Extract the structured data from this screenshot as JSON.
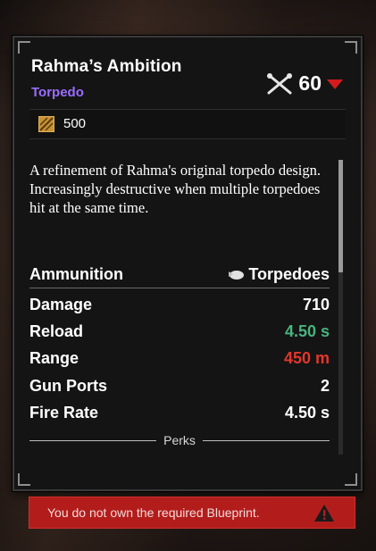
{
  "item": {
    "name": "Rahma’s Ambition",
    "type": "Torpedo",
    "power_value": "60",
    "power_icon": "crossed-cannons-icon",
    "power_trend_icon": "down-triangle-icon",
    "cost_value": "500",
    "cost_icon": "material-crate-icon",
    "description": "A refinement of Rahma's original torpedo design. Increasingly destructive when multiple torpedoes hit at the same time."
  },
  "ammunition": {
    "label": "Ammunition",
    "value": "Torpedoes",
    "icon": "torpedo-icon"
  },
  "stats": [
    {
      "label": "Damage",
      "value": "710",
      "color": "#ffffff"
    },
    {
      "label": "Reload",
      "value": "4.50 s",
      "color": "#49b47f"
    },
    {
      "label": "Range",
      "value": "450 m",
      "color": "#e2372c"
    },
    {
      "label": "Gun Ports",
      "value": "2",
      "color": "#ffffff"
    },
    {
      "label": "Fire Rate",
      "value": "4.50 s",
      "color": "#ffffff"
    }
  ],
  "perks_label": "Perks",
  "warning": {
    "text": "You do not own the required Blueprint.",
    "icon": "warning-triangle-icon",
    "color": "#b21d1b"
  },
  "colors": {
    "type_accent": "#9b6dff",
    "power_down": "#d41c1c"
  }
}
